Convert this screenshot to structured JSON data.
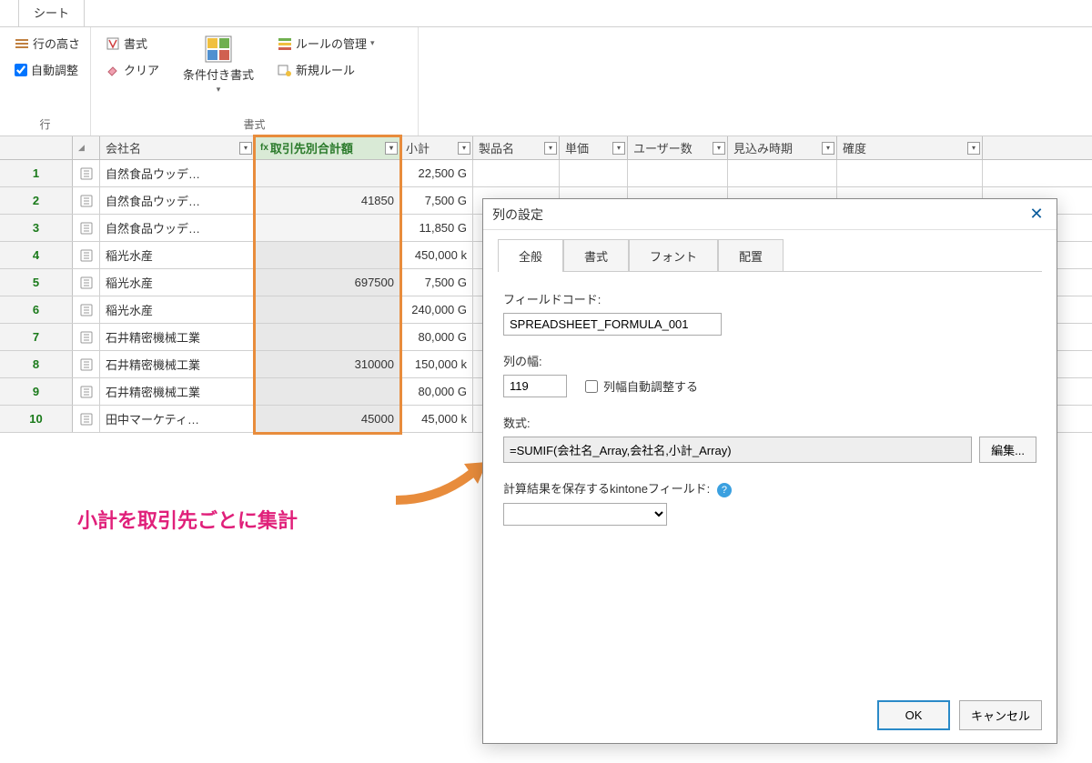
{
  "tabbar": {
    "sheet": "シート"
  },
  "ribbon": {
    "group_row": {
      "label": "行",
      "row_height": "行の高さ",
      "autofit": "自動調整"
    },
    "group_format": {
      "label": "書式",
      "format": "書式",
      "clear": "クリア",
      "cond_format": "条件付き書式",
      "manage_rules": "ルールの管理",
      "new_rule": "新規ルール"
    }
  },
  "columns": {
    "company": "会社名",
    "total_by_client": "取引先別合計額",
    "subtotal": "小計",
    "product": "製品名",
    "unit_price": "単価",
    "users": "ユーザー数",
    "expected": "見込み時期",
    "confidence": "確度"
  },
  "rows": [
    {
      "n": "1",
      "company": "自然食品ウッデ…",
      "total": "",
      "sub": "22,500 G"
    },
    {
      "n": "2",
      "company": "自然食品ウッデ…",
      "total": "41850",
      "sub": "7,500 G"
    },
    {
      "n": "3",
      "company": "自然食品ウッデ…",
      "total": "",
      "sub": "11,850 G"
    },
    {
      "n": "4",
      "company": "稲光水産",
      "total": "",
      "sub": "450,000 k"
    },
    {
      "n": "5",
      "company": "稲光水産",
      "total": "697500",
      "sub": "7,500 G"
    },
    {
      "n": "6",
      "company": "稲光水産",
      "total": "",
      "sub": "240,000 G"
    },
    {
      "n": "7",
      "company": "石井精密機械工業",
      "total": "",
      "sub": "80,000 G"
    },
    {
      "n": "8",
      "company": "石井精密機械工業",
      "total": "310000",
      "sub": "150,000 k"
    },
    {
      "n": "9",
      "company": "石井精密機械工業",
      "total": "",
      "sub": "80,000 G"
    },
    {
      "n": "10",
      "company": "田中マーケティ…",
      "total": "45000",
      "sub": "45,000 k"
    }
  ],
  "annotation": "小計を取引先ごとに集計",
  "dialog": {
    "title": "列の設定",
    "tabs": {
      "general": "全般",
      "format": "書式",
      "font": "フォント",
      "align": "配置"
    },
    "field_code_label": "フィールドコード:",
    "field_code_value": "SPREADSHEET_FORMULA_001",
    "col_width_label": "列の幅:",
    "col_width_value": "119",
    "autofit_label": "列幅自動調整する",
    "formula_label": "数式:",
    "formula_value": "=SUMIF(会社名_Array,会社名,小計_Array)",
    "edit_btn": "編集...",
    "save_label": "計算結果を保存するkintoneフィールド:",
    "ok": "OK",
    "cancel": "キャンセル"
  }
}
